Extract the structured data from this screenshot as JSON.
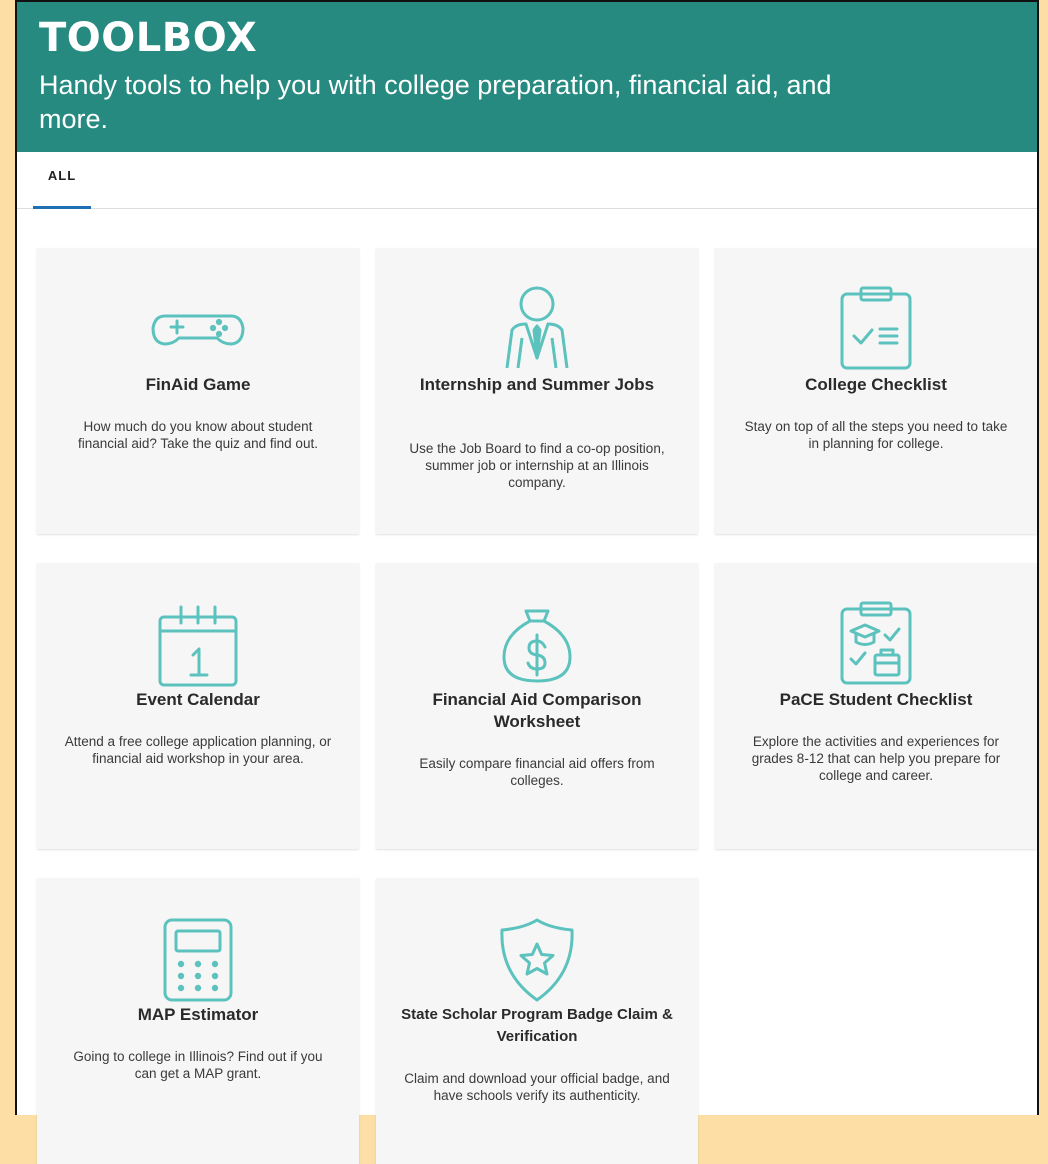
{
  "header": {
    "title": "TOOLBOX",
    "subtitle": "Handy tools to help you with college preparation, financial aid, and more."
  },
  "tabs": [
    {
      "label": "ALL",
      "active": true
    }
  ],
  "colors": {
    "header_bg": "#268a80",
    "icon": "#5cc2bd",
    "tab_underline": "#1f6fb5",
    "page_bg": "#fddfa6"
  },
  "cards": [
    {
      "icon": "game-controller-icon",
      "title": "FinAid Game",
      "description": "How much do you know about student financial aid? Take the quiz and find out."
    },
    {
      "icon": "person-suit-icon",
      "title": "Internship and Summer Jobs",
      "description": "Use the Job Board to find a co-op position, summer job or internship at an Illinois company."
    },
    {
      "icon": "clipboard-checklist-icon",
      "title": "College Checklist",
      "description": "Stay on top of all the steps you need to take in planning for college."
    },
    {
      "icon": "calendar-icon",
      "title": "Event Calendar",
      "description": "Attend a free college application planning, or financial aid workshop in your area."
    },
    {
      "icon": "money-bag-icon",
      "title": "Financial Aid Comparison Worksheet",
      "description": "Easily compare financial aid offers from colleges."
    },
    {
      "icon": "student-checklist-icon",
      "title": "PaCE Student Checklist",
      "description": "Explore the activities and experiences for grades 8-12 that can help you prepare for college and career."
    },
    {
      "icon": "calculator-icon",
      "title": "MAP Estimator",
      "description": "Going to college in Illinois? Find out if you can get a MAP grant."
    },
    {
      "icon": "shield-star-icon",
      "title": "State Scholar Program Badge Claim & Verification",
      "description": "Claim and download your official badge, and have schools verify its authenticity."
    }
  ]
}
